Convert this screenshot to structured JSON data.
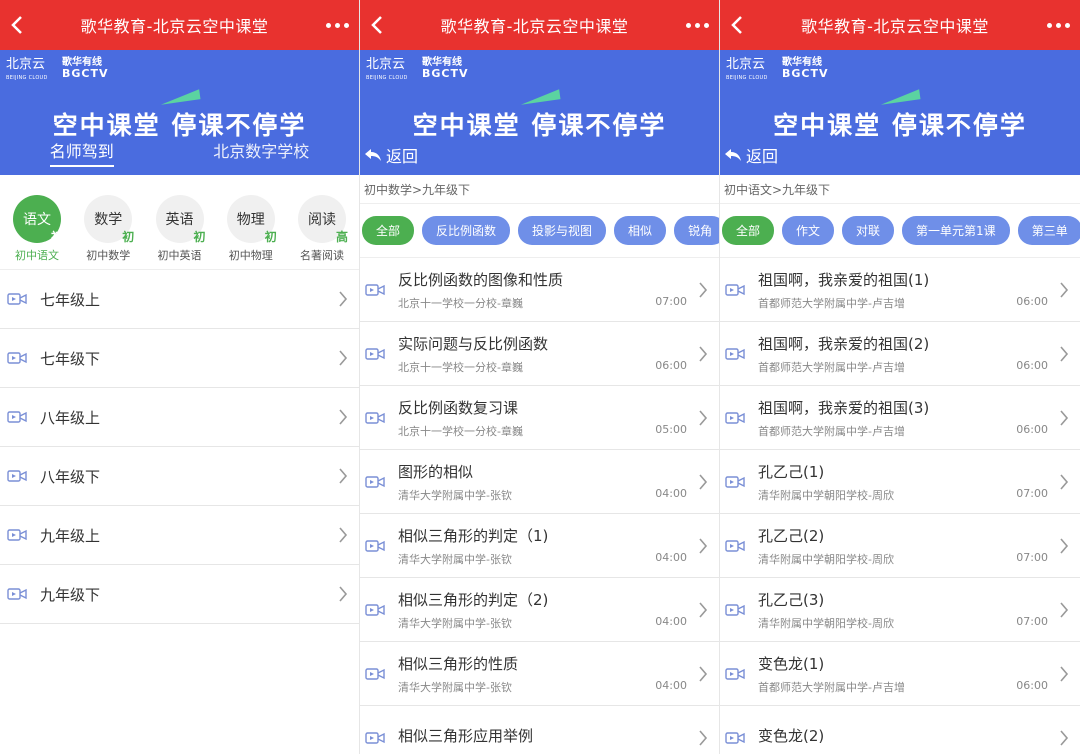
{
  "app": {
    "title": "歌华教育-北京云空中课堂"
  },
  "banner": {
    "logo_main": "北京云",
    "logo_sub": "BEIJING CLOUD",
    "logo_brand": "歌华有线",
    "logo_brand_en": "BGCTV",
    "slogan": "空中课堂 停课不停学",
    "tab_active": "名师驾到",
    "tab_inactive": "北京数字学校",
    "back_label": "返回"
  },
  "screen1": {
    "subjects": [
      {
        "name": "语文",
        "level": "初",
        "caption": "初中语文",
        "active": true
      },
      {
        "name": "数学",
        "level": "初",
        "caption": "初中数学",
        "active": false
      },
      {
        "name": "英语",
        "level": "初",
        "caption": "初中英语",
        "active": false
      },
      {
        "name": "物理",
        "level": "初",
        "caption": "初中物理",
        "active": false
      },
      {
        "name": "阅读",
        "level": "高",
        "caption": "名著阅读",
        "active": false
      }
    ],
    "grades": [
      "七年级上",
      "七年级下",
      "八年级上",
      "八年级下",
      "九年级上",
      "九年级下"
    ]
  },
  "screen2": {
    "breadcrumb": "初中数学>九年级下",
    "filters": [
      "全部",
      "反比例函数",
      "投影与视图",
      "相似",
      "锐角"
    ],
    "lessons": [
      {
        "title": "反比例函数的图像和性质",
        "teacher": "北京十一学校一分校-章巍",
        "time": "07:00"
      },
      {
        "title": "实际问题与反比例函数",
        "teacher": "北京十一学校一分校-章巍",
        "time": "06:00"
      },
      {
        "title": "反比例函数复习课",
        "teacher": "北京十一学校一分校-章巍",
        "time": "05:00"
      },
      {
        "title": "图形的相似",
        "teacher": "清华大学附属中学-张钦",
        "time": "04:00"
      },
      {
        "title": "相似三角形的判定（1)",
        "teacher": "清华大学附属中学-张钦",
        "time": "04:00"
      },
      {
        "title": "相似三角形的判定（2)",
        "teacher": "清华大学附属中学-张钦",
        "time": "04:00"
      },
      {
        "title": "相似三角形的性质",
        "teacher": "清华大学附属中学-张钦",
        "time": "04:00"
      },
      {
        "title": "相似三角形应用举例",
        "teacher": "",
        "time": ""
      }
    ]
  },
  "screen3": {
    "breadcrumb": "初中语文>九年级下",
    "filters": [
      "全部",
      "作文",
      "对联",
      "第一单元第1课",
      "第三单"
    ],
    "lessons": [
      {
        "title": "祖国啊，我亲爱的祖国(1)",
        "teacher": "首都师范大学附属中学-卢吉增",
        "time": "06:00"
      },
      {
        "title": "祖国啊，我亲爱的祖国(2)",
        "teacher": "首都师范大学附属中学-卢吉增",
        "time": "06:00"
      },
      {
        "title": "祖国啊，我亲爱的祖国(3)",
        "teacher": "首都师范大学附属中学-卢吉增",
        "time": "06:00"
      },
      {
        "title": "孔乙己(1)",
        "teacher": "清华附属中学朝阳学校-周欣",
        "time": "07:00"
      },
      {
        "title": "孔乙己(2)",
        "teacher": "清华附属中学朝阳学校-周欣",
        "time": "07:00"
      },
      {
        "title": "孔乙己(3)",
        "teacher": "清华附属中学朝阳学校-周欣",
        "time": "07:00"
      },
      {
        "title": "变色龙(1)",
        "teacher": "首都师范大学附属中学-卢吉增",
        "time": "06:00"
      },
      {
        "title": "变色龙(2)",
        "teacher": "",
        "time": ""
      }
    ]
  },
  "colors": {
    "topbar": "#e8322f",
    "banner": "#4a6cdf",
    "accent_green": "#4caf50",
    "chip_blue": "#6f8fe8"
  },
  "icons": {
    "back": "chevron-left-icon",
    "more": "more-dots-icon",
    "video": "video-icon",
    "chevron": "chevron-right-icon",
    "return": "return-arrow-icon"
  }
}
